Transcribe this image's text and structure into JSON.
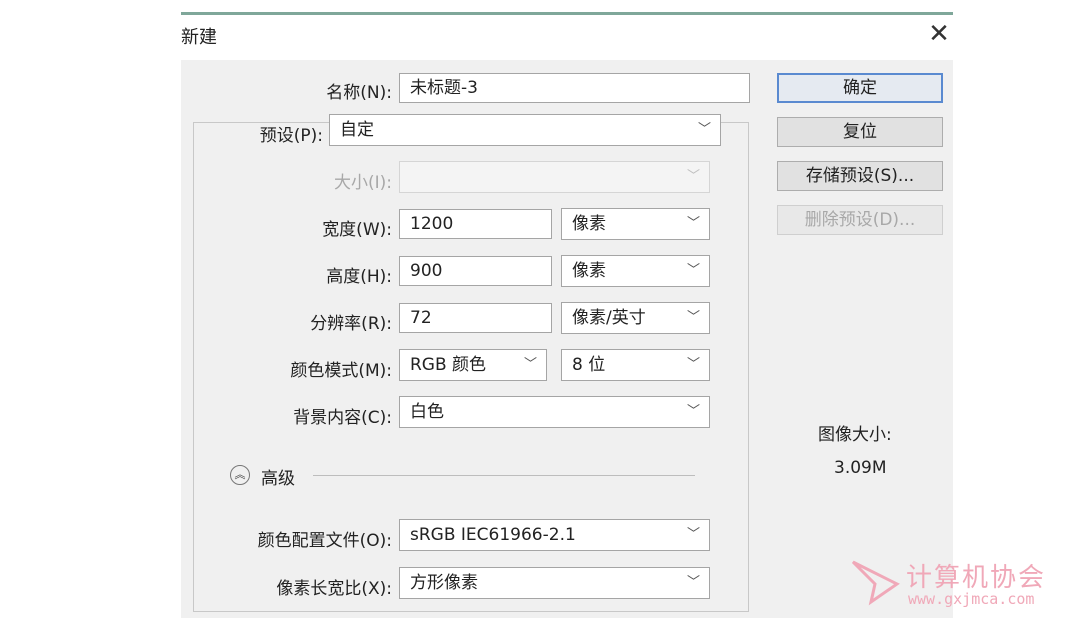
{
  "dialog": {
    "title": "新建",
    "close_glyph": "✕"
  },
  "form": {
    "name_label": "名称(N):",
    "name_value": "未标题-3",
    "preset_label": "预设(P):",
    "preset_value": "自定",
    "size_label": "大小(I):",
    "size_value": "",
    "width_label": "宽度(W):",
    "width_value": "1200",
    "width_unit": "像素",
    "height_label": "高度(H):",
    "height_value": "900",
    "height_unit": "像素",
    "resolution_label": "分辨率(R):",
    "resolution_value": "72",
    "resolution_unit": "像素/英寸",
    "color_mode_label": "颜色模式(M):",
    "color_mode_value": "RGB 颜色",
    "bit_depth_value": "8 位",
    "background_label": "背景内容(C):",
    "background_value": "白色",
    "advanced_label": "高级",
    "profile_label": "颜色配置文件(O):",
    "profile_value": "sRGB IEC61966-2.1",
    "aspect_label": "像素长宽比(X):",
    "aspect_value": "方形像素"
  },
  "buttons": {
    "ok": "确定",
    "reset": "复位",
    "save_preset": "存储预设(S)...",
    "delete_preset": "删除预设(D)..."
  },
  "image_size": {
    "label": "图像大小:",
    "value": "3.09M"
  },
  "watermark": {
    "title": "计算机协会",
    "url": "www.gxjmca.com"
  },
  "icons": {
    "chevron": "chevron-down-icon",
    "advanced": "collapse-up-icon",
    "close": "close-icon"
  },
  "colors": {
    "accent_border": "#5a8ad0",
    "watermark": "#f0a8b8"
  }
}
